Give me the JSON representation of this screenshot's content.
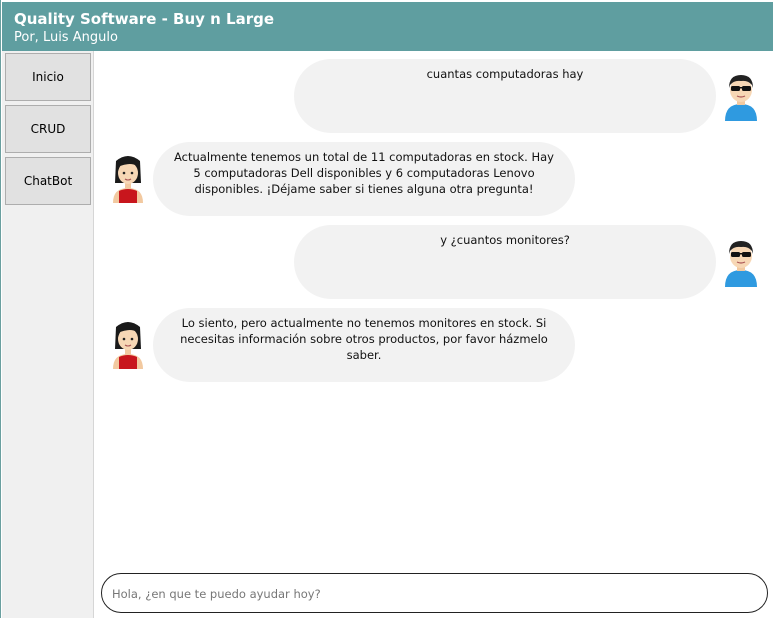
{
  "header": {
    "title": "Quality Software - Buy n Large",
    "subtitle": "Por, Luis Angulo",
    "background": "#5f9ea0"
  },
  "sidebar": {
    "items": [
      {
        "label": "Inicio"
      },
      {
        "label": "CRUD"
      },
      {
        "label": "ChatBot"
      }
    ]
  },
  "messages": [
    {
      "sender": "user",
      "avatar": "user-sunglasses-icon",
      "text": "cuantas computadoras hay"
    },
    {
      "sender": "bot",
      "avatar": "woman-assistant-icon",
      "text": "Actualmente tenemos un total de 11 computadoras en stock. Hay 5 computadoras Dell disponibles y 6 computadoras Lenovo disponibles. ¡Déjame saber si tienes alguna otra pregunta!"
    },
    {
      "sender": "user",
      "avatar": "user-sunglasses-icon",
      "text": "y ¿cuantos monitores?"
    },
    {
      "sender": "bot",
      "avatar": "woman-assistant-icon",
      "text": "Lo siento, pero actualmente no tenemos monitores en stock. Si necesitas información sobre otros productos, por favor házmelo saber."
    }
  ],
  "input": {
    "placeholder": "Hola, ¿en que te puedo ayudar hoy?",
    "value": ""
  }
}
